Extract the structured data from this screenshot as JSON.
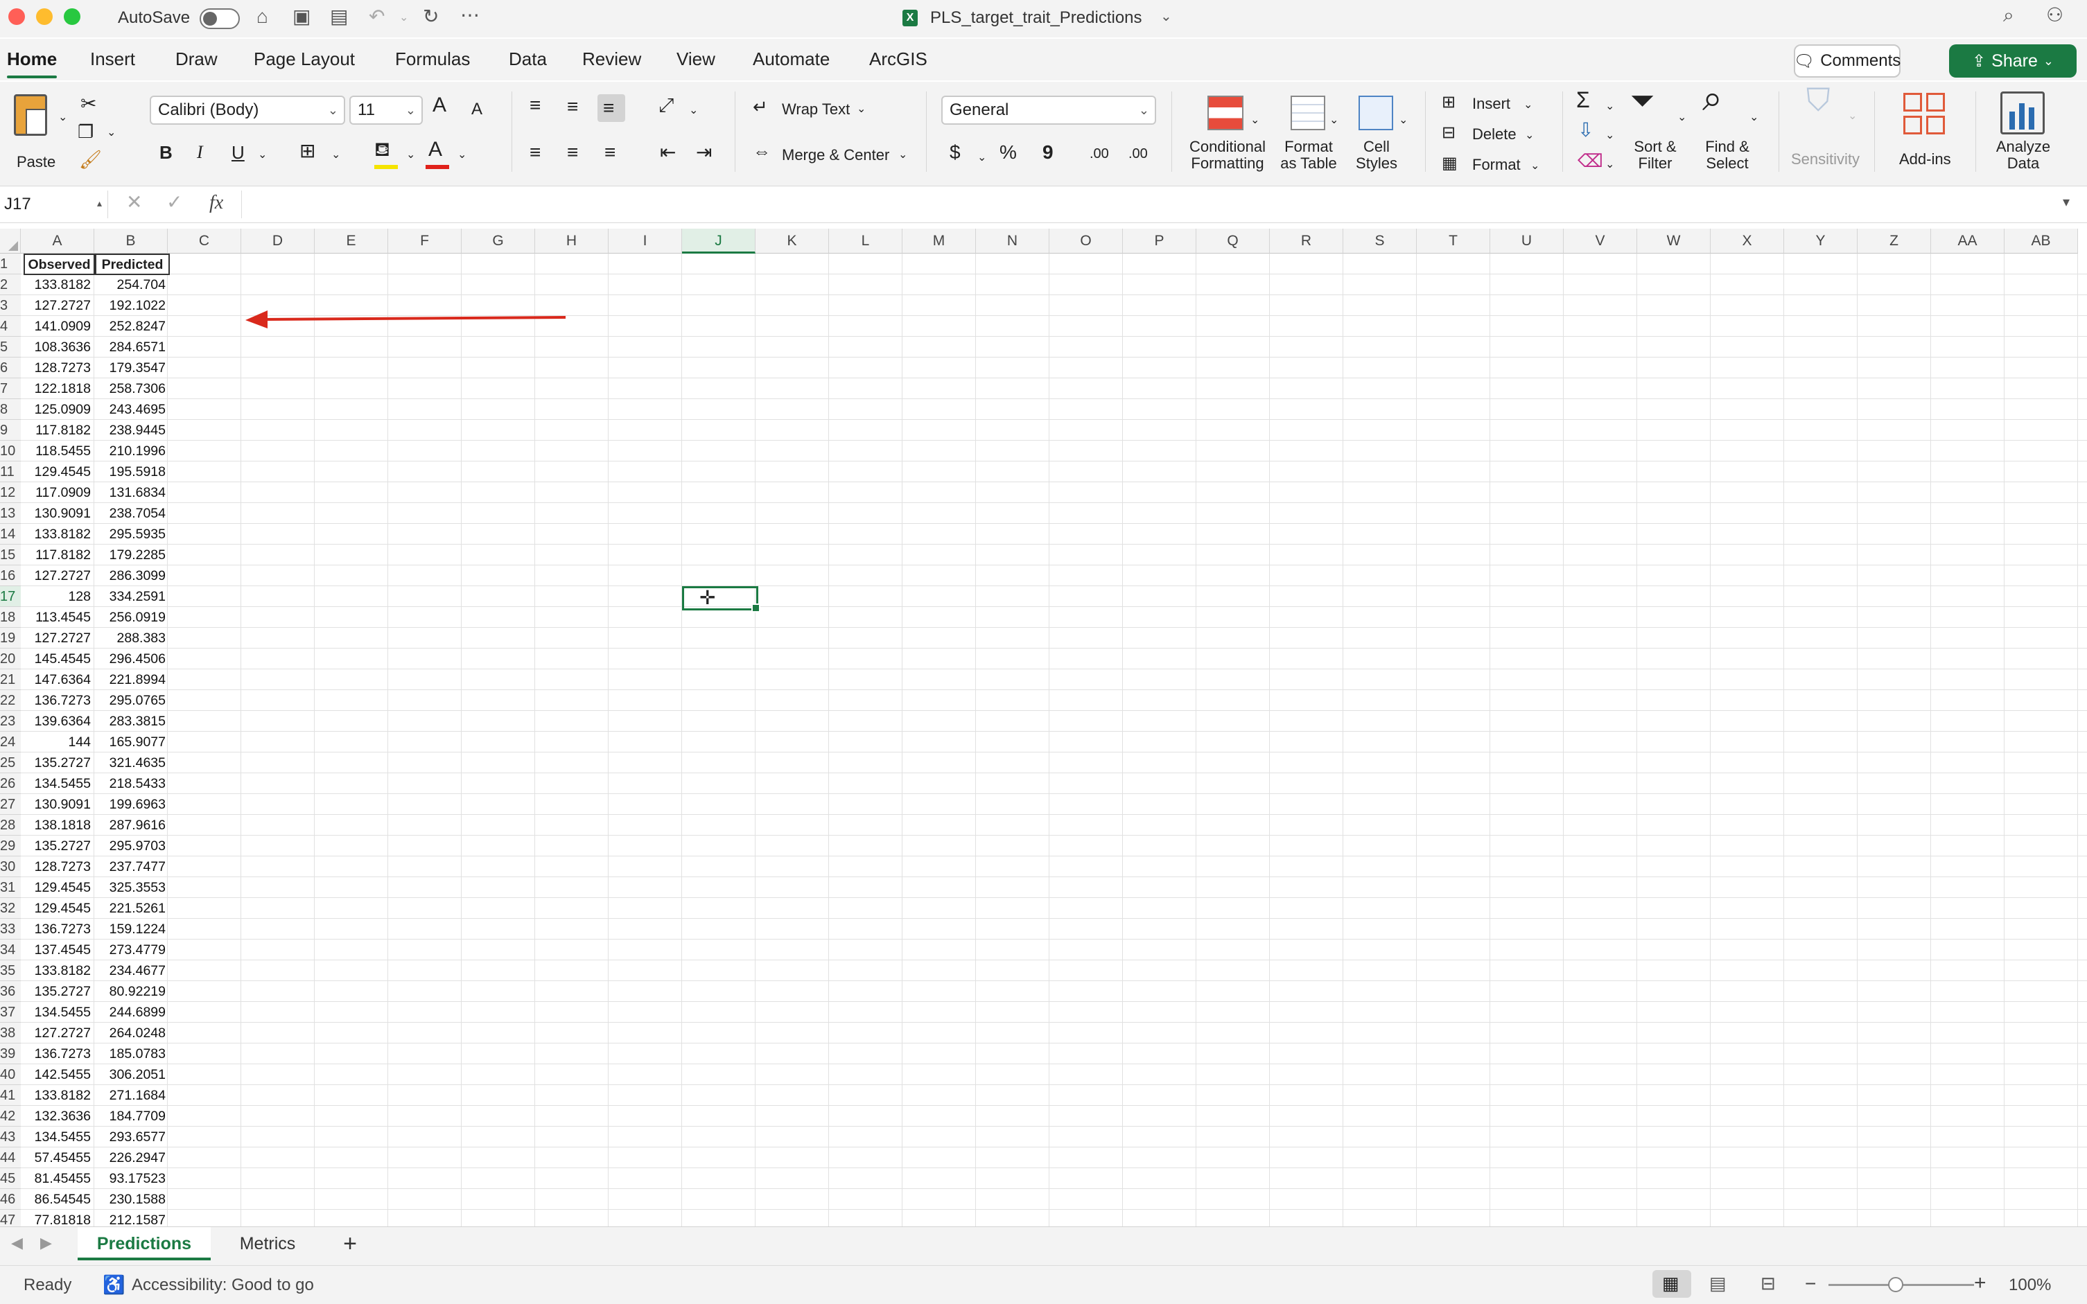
{
  "titlebar": {
    "autosave_label": "AutoSave",
    "file_name": "PLS_target_trait_Predictions"
  },
  "ribbon_tabs": [
    "Home",
    "Insert",
    "Draw",
    "Page Layout",
    "Formulas",
    "Data",
    "Review",
    "View",
    "Automate",
    "ArcGIS"
  ],
  "comments_label": "Comments",
  "share_label": "Share",
  "ribbon": {
    "paste_label": "Paste",
    "font_name": "Calibri (Body)",
    "font_size": "11",
    "wrap_text": "Wrap Text",
    "merge_center": "Merge & Center",
    "number_format": "General",
    "conditional_formatting_1": "Conditional",
    "conditional_formatting_2": "Formatting",
    "format_table_1": "Format",
    "format_table_2": "as Table",
    "cell_styles_1": "Cell",
    "cell_styles_2": "Styles",
    "insert": "Insert",
    "delete": "Delete",
    "format": "Format",
    "sort_filter_1": "Sort &",
    "sort_filter_2": "Filter",
    "find_select_1": "Find &",
    "find_select_2": "Select",
    "sensitivity": "Sensitivity",
    "addins": "Add-ins",
    "analyze_1": "Analyze",
    "analyze_2": "Data",
    "bold": "B",
    "italic": "I",
    "underline": "U",
    "font_color_glyph": "A",
    "currency": "$",
    "percent": "%",
    "comma": "9",
    "grow_font": "A",
    "shrink_font": "A",
    "inc_dec": ".00",
    "dec_dec": ".00"
  },
  "formula_bar": {
    "name_box": "J17",
    "fx": "fx",
    "content": ""
  },
  "columns": [
    "A",
    "B",
    "C",
    "D",
    "E",
    "F",
    "G",
    "H",
    "I",
    "J",
    "K",
    "L",
    "M",
    "N",
    "O",
    "P",
    "Q",
    "R",
    "S",
    "T",
    "U",
    "V",
    "W",
    "X",
    "Y",
    "Z",
    "AA",
    "AB"
  ],
  "selected_column": "J",
  "selected_row": 17,
  "sheet": {
    "header_a": "Observed",
    "header_b": "Predicted",
    "rows": [
      [
        "133.8182",
        "254.704"
      ],
      [
        "127.2727",
        "192.1022"
      ],
      [
        "141.0909",
        "252.8247"
      ],
      [
        "108.3636",
        "284.6571"
      ],
      [
        "128.7273",
        "179.3547"
      ],
      [
        "122.1818",
        "258.7306"
      ],
      [
        "125.0909",
        "243.4695"
      ],
      [
        "117.8182",
        "238.9445"
      ],
      [
        "118.5455",
        "210.1996"
      ],
      [
        "129.4545",
        "195.5918"
      ],
      [
        "117.0909",
        "131.6834"
      ],
      [
        "130.9091",
        "238.7054"
      ],
      [
        "133.8182",
        "295.5935"
      ],
      [
        "117.8182",
        "179.2285"
      ],
      [
        "127.2727",
        "286.3099"
      ],
      [
        "128",
        "334.2591"
      ],
      [
        "113.4545",
        "256.0919"
      ],
      [
        "127.2727",
        "288.383"
      ],
      [
        "145.4545",
        "296.4506"
      ],
      [
        "147.6364",
        "221.8994"
      ],
      [
        "136.7273",
        "295.0765"
      ],
      [
        "139.6364",
        "283.3815"
      ],
      [
        "144",
        "165.9077"
      ],
      [
        "135.2727",
        "321.4635"
      ],
      [
        "134.5455",
        "218.5433"
      ],
      [
        "130.9091",
        "199.6963"
      ],
      [
        "138.1818",
        "287.9616"
      ],
      [
        "135.2727",
        "295.9703"
      ],
      [
        "128.7273",
        "237.7477"
      ],
      [
        "129.4545",
        "325.3553"
      ],
      [
        "129.4545",
        "221.5261"
      ],
      [
        "136.7273",
        "159.1224"
      ],
      [
        "137.4545",
        "273.4779"
      ],
      [
        "133.8182",
        "234.4677"
      ],
      [
        "135.2727",
        "80.92219"
      ],
      [
        "134.5455",
        "244.6899"
      ],
      [
        "127.2727",
        "264.0248"
      ],
      [
        "136.7273",
        "185.0783"
      ],
      [
        "142.5455",
        "306.2051"
      ],
      [
        "133.8182",
        "271.1684"
      ],
      [
        "132.3636",
        "184.7709"
      ],
      [
        "134.5455",
        "293.6577"
      ],
      [
        "57.45455",
        "226.2947"
      ],
      [
        "81.45455",
        "93.17523"
      ],
      [
        "86.54545",
        "230.1588"
      ],
      [
        "77.81818",
        "212.1587"
      ]
    ]
  },
  "sheet_tabs": [
    "Predictions",
    "Metrics"
  ],
  "active_sheet": "Predictions",
  "add_sheet": "+",
  "status": {
    "ready": "Ready",
    "accessibility": "Accessibility: Good to go",
    "zoom": "100%",
    "zoom_minus": "−",
    "zoom_plus": "+"
  },
  "colors": {
    "accent": "#1b7a43",
    "arrow": "#d9291c"
  }
}
